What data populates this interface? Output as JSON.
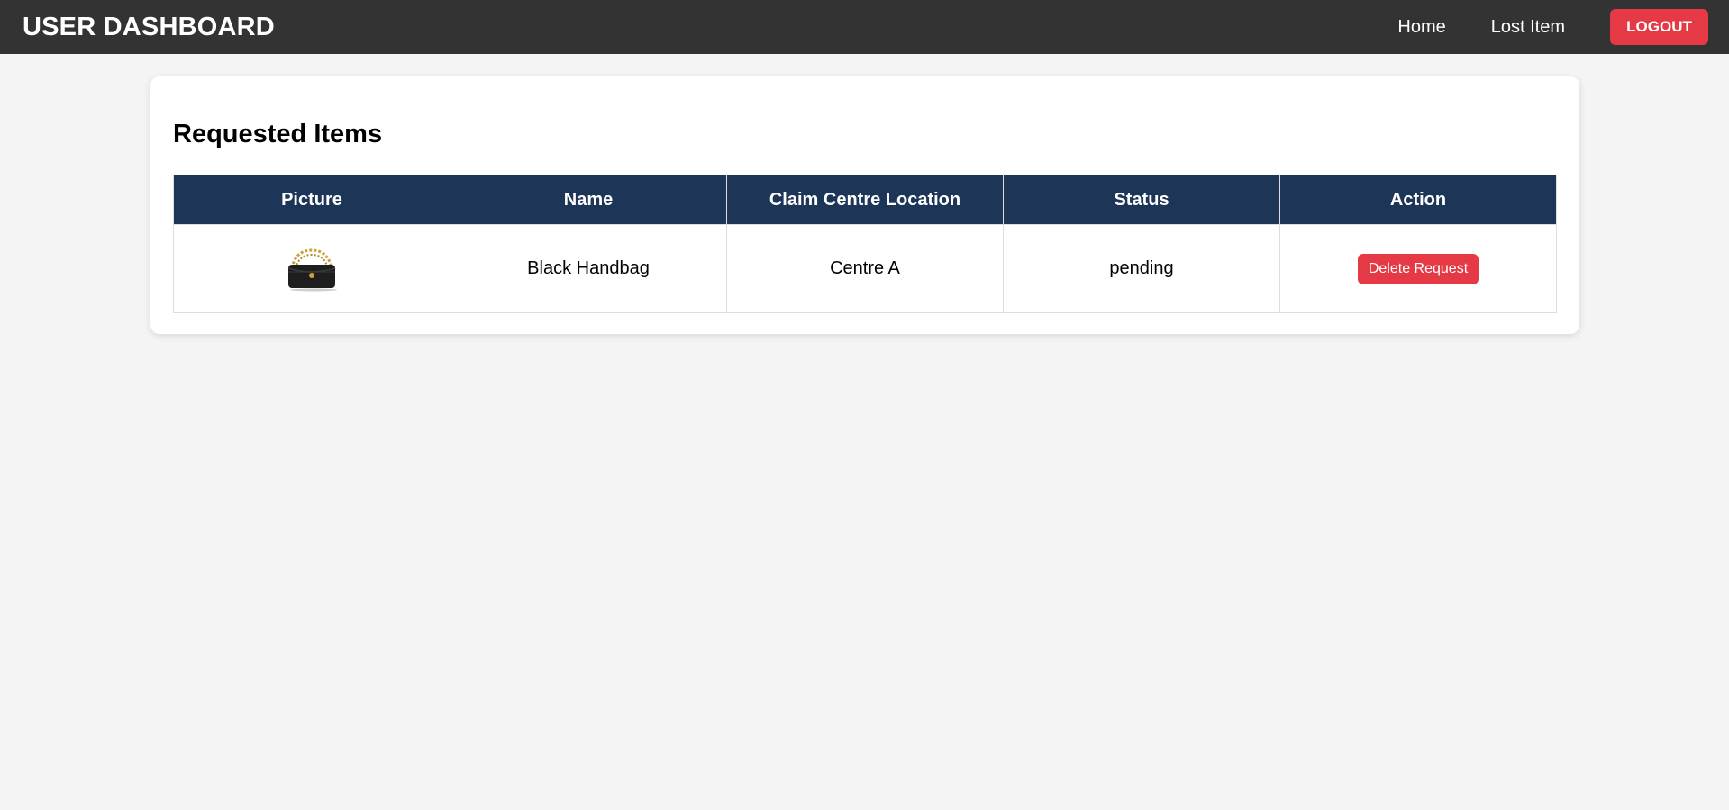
{
  "header": {
    "title": "USER DASHBOARD",
    "nav": [
      {
        "label": "Home"
      },
      {
        "label": "Lost Item"
      }
    ],
    "logout_label": "LOGOUT"
  },
  "main": {
    "section_title": "Requested Items",
    "table": {
      "columns": [
        "Picture",
        "Name",
        "Claim Centre Location",
        "Status",
        "Action"
      ],
      "rows": [
        {
          "picture_icon": "black-handbag-image",
          "name": "Black Handbag",
          "location": "Centre A",
          "status": "pending",
          "action_label": "Delete Request"
        }
      ]
    }
  },
  "colors": {
    "header_bg": "#333333",
    "table_header_bg": "#1d3557",
    "accent_red": "#e63946",
    "page_bg": "#f4f4f4"
  }
}
